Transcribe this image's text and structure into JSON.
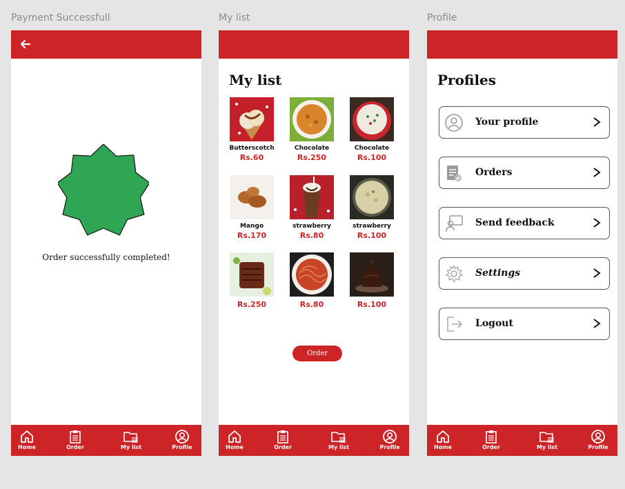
{
  "colors": {
    "accent": "#cc2427",
    "star": "#2fa653"
  },
  "frames": {
    "payment": "Payment Successfull",
    "mylist": "My list",
    "profile": "Profile"
  },
  "nav": {
    "home": "Home",
    "order": "Order",
    "mylist": "My list",
    "profile": "Profile"
  },
  "payment": {
    "message": "Order successfully completed!"
  },
  "mylist": {
    "title": "My list",
    "order_button": "Order",
    "items": [
      {
        "name": "Butterscotch",
        "price": "Rs.60",
        "image": "butterscotch-icecream"
      },
      {
        "name": "Chocolate",
        "price": "Rs.250",
        "image": "biryani"
      },
      {
        "name": "Chocolate",
        "price": "Rs.100",
        "image": "veg-rice"
      },
      {
        "name": "Mango",
        "price": "Rs.170",
        "image": "fried-chicken"
      },
      {
        "name": "strawberry",
        "price": "Rs.80",
        "image": "chocolate-shake"
      },
      {
        "name": "strawberry",
        "price": "Rs.100",
        "image": "mushroom-curry"
      },
      {
        "name": "",
        "price": "Rs.250",
        "image": "grilled-fish"
      },
      {
        "name": "",
        "price": "Rs.80",
        "image": "spaghetti"
      },
      {
        "name": "",
        "price": "Rs.100",
        "image": "chocolate-cake"
      }
    ]
  },
  "profile": {
    "title": "Profiles",
    "items": [
      {
        "label": "Your profile",
        "icon": "user-circle-icon"
      },
      {
        "label": "Orders",
        "icon": "orders-icon"
      },
      {
        "label": "Send feedback",
        "icon": "feedback-icon"
      },
      {
        "label": "Settings",
        "icon": "gear-icon"
      },
      {
        "label": "Logout",
        "icon": "logout-icon"
      }
    ]
  }
}
